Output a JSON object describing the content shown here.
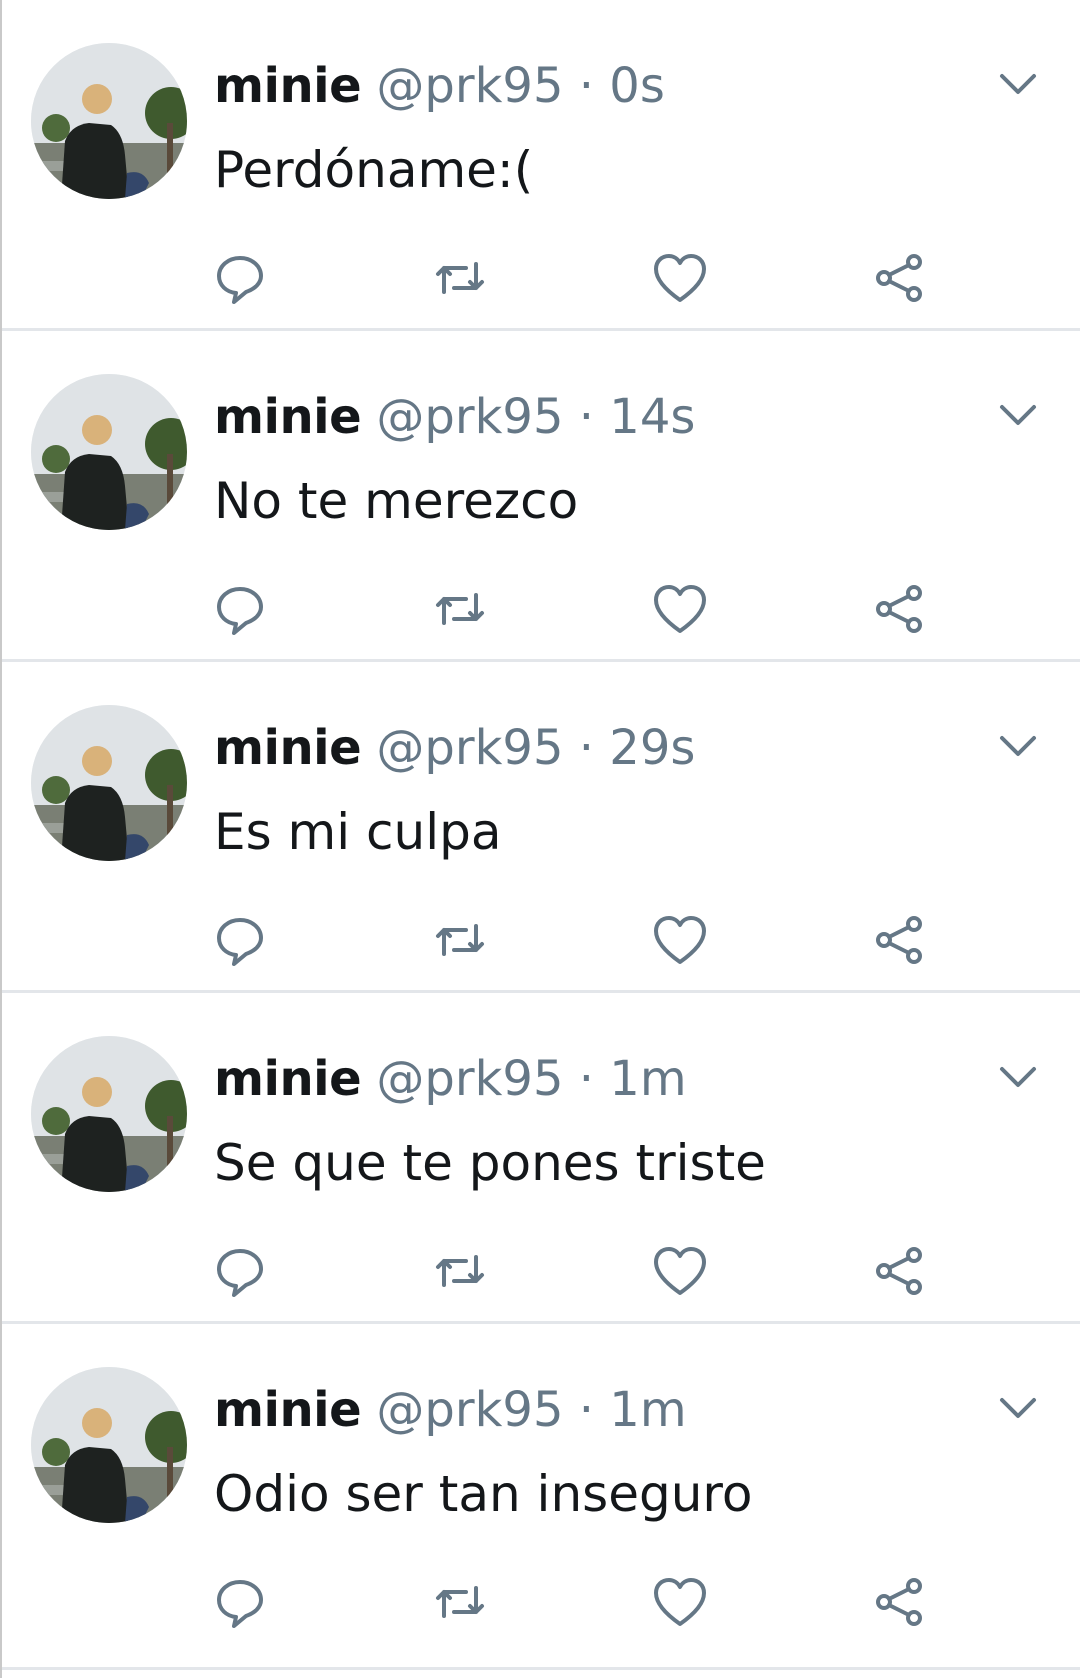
{
  "icons": {
    "reply": "reply-icon",
    "retweet": "retweet-icon",
    "like": "heart-icon",
    "share": "share-icon",
    "menu": "chevron-down-icon"
  },
  "colors": {
    "name": "#14171a",
    "secondary": "#657786",
    "divider": "#e3e6ea",
    "background": "#ffffff"
  },
  "tweets": [
    {
      "name": "minie",
      "handle": "@prk95",
      "separator": "·",
      "time": "0s",
      "text": "Perdóname:("
    },
    {
      "name": "minie",
      "handle": "@prk95",
      "separator": "·",
      "time": "14s",
      "text": "No te merezco"
    },
    {
      "name": "minie",
      "handle": "@prk95",
      "separator": "·",
      "time": "29s",
      "text": "Es mi culpa"
    },
    {
      "name": "minie",
      "handle": "@prk95",
      "separator": "·",
      "time": "1m",
      "text": "Se que te pones triste"
    },
    {
      "name": "minie",
      "handle": "@prk95",
      "separator": "·",
      "time": "1m",
      "text": "Odio ser tan inseguro"
    }
  ]
}
